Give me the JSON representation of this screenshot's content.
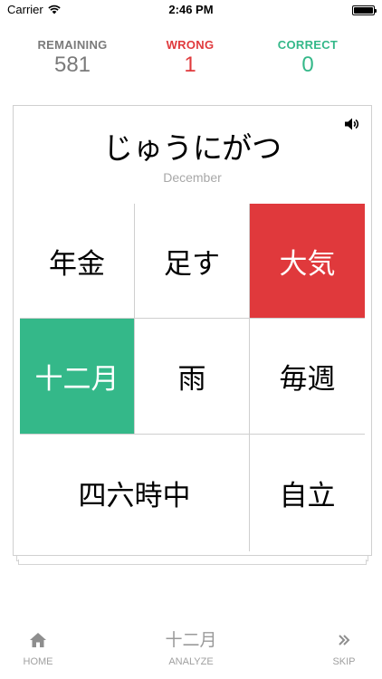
{
  "status_bar": {
    "carrier": "Carrier",
    "time": "2:46 PM"
  },
  "stats": {
    "remaining": {
      "label": "REMAINING",
      "value": "581",
      "color": "#7a7a7a"
    },
    "wrong": {
      "label": "WRONG",
      "value": "1",
      "color": "#e0393c"
    },
    "correct": {
      "label": "CORRECT",
      "value": "0",
      "color": "#34b889"
    }
  },
  "card": {
    "word": "じゅうにがつ",
    "meaning": "December",
    "speaker_icon": "speaker-icon",
    "choices": [
      {
        "text": "年金",
        "state": "normal"
      },
      {
        "text": "足す",
        "state": "normal"
      },
      {
        "text": "大気",
        "state": "wrong"
      },
      {
        "text": "十二月",
        "state": "correct"
      },
      {
        "text": "雨",
        "state": "normal"
      },
      {
        "text": "毎週",
        "state": "normal"
      },
      {
        "text": "四六時中",
        "state": "normal"
      },
      {
        "text": "自立",
        "state": "normal"
      }
    ]
  },
  "toolbar": {
    "home_label": "HOME",
    "home_icon": "home-icon",
    "analyze_text": "十二月",
    "analyze_label": "ANALYZE",
    "skip_label": "SKIP",
    "skip_icon": "double-chevron-right-icon",
    "label_color": "#a0a0a0"
  },
  "colors": {
    "wrong_fill": "#e0393c",
    "correct_fill": "#34b889"
  }
}
